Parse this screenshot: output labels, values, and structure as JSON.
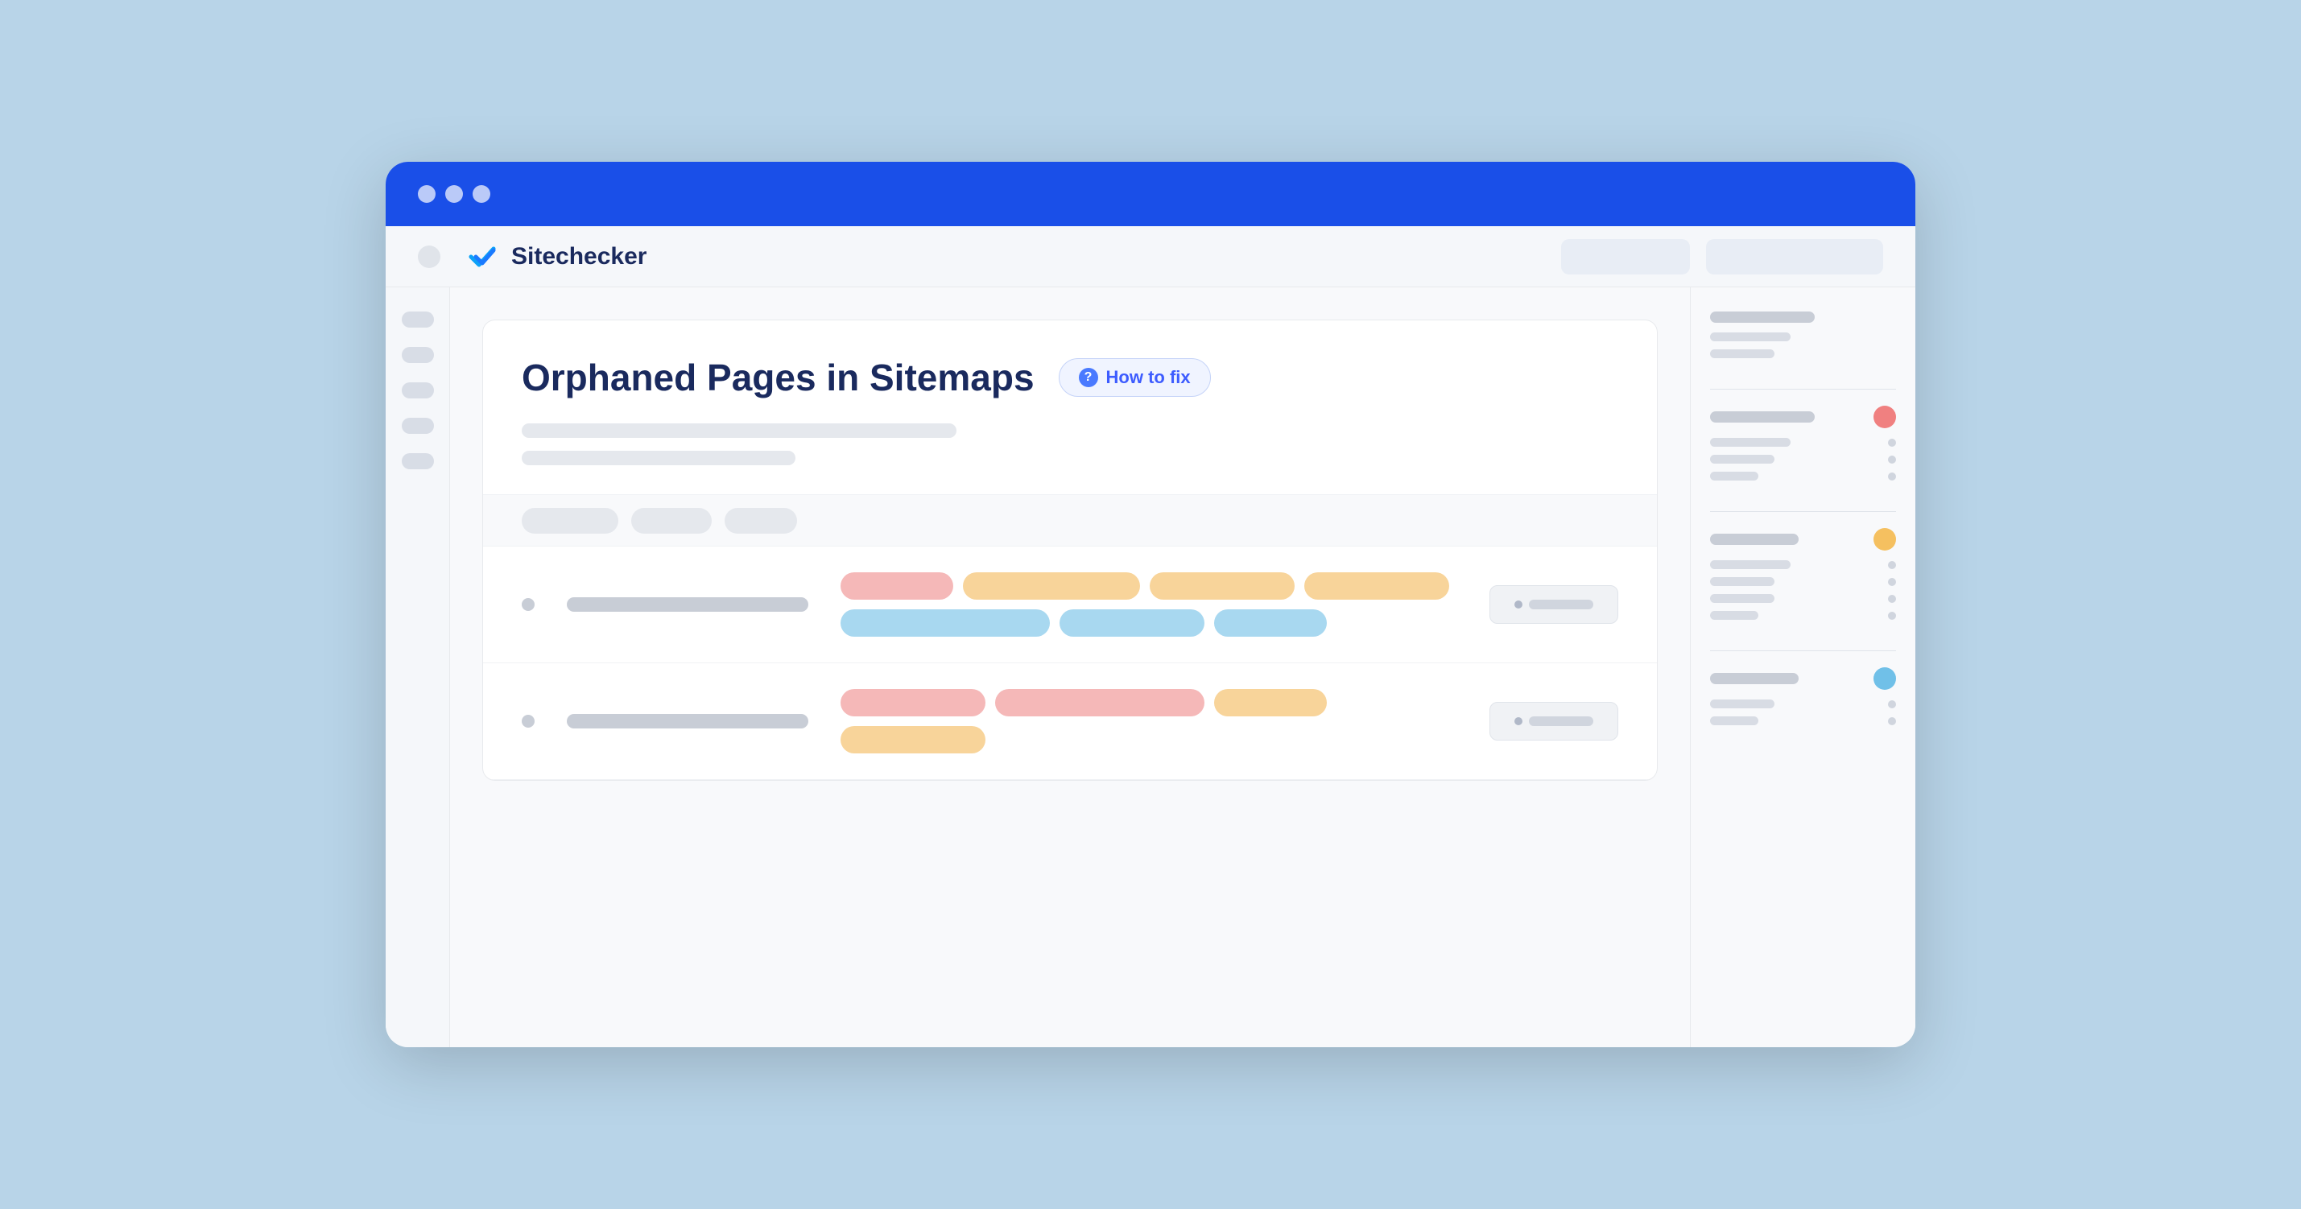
{
  "browser": {
    "title": "Sitechecker",
    "dots": [
      "dot1",
      "dot2",
      "dot3"
    ],
    "btn1_label": "",
    "btn2_label": ""
  },
  "page": {
    "title": "Orphaned Pages in Sitemaps",
    "how_to_fix": "How to fix",
    "desc_line1": "",
    "desc_line2": ""
  },
  "sidebar_items": [
    "item1",
    "item2",
    "item3",
    "item4",
    "item5"
  ],
  "table": {
    "rows": [
      {
        "tags": [
          {
            "color": "pink",
            "size": "sm"
          },
          {
            "color": "orange",
            "size": "lg"
          },
          {
            "color": "orange",
            "size": "md"
          },
          {
            "color": "orange",
            "size": "md"
          },
          {
            "color": "blue",
            "size": "xl"
          },
          {
            "color": "blue",
            "size": "md"
          },
          {
            "color": "blue",
            "size": "sm"
          }
        ]
      },
      {
        "tags": [
          {
            "color": "pink",
            "size": "md"
          },
          {
            "color": "pink",
            "size": "xl"
          },
          {
            "color": "orange",
            "size": "sm"
          },
          {
            "color": "orange",
            "size": "md"
          }
        ]
      }
    ]
  },
  "right_sidebar": {
    "sections": [
      {
        "main_line": "lg",
        "badge": "none",
        "sub_rows": [
          {
            "line": "md",
            "dot": false
          },
          {
            "line": "sm",
            "dot": false
          }
        ]
      },
      {
        "main_line": "lg",
        "badge": "red",
        "sub_rows": [
          {
            "line": "md",
            "dot": true
          },
          {
            "line": "sm",
            "dot": true
          },
          {
            "line": "xs",
            "dot": true
          }
        ]
      },
      {
        "main_line": "md",
        "badge": "orange",
        "sub_rows": [
          {
            "line": "md",
            "dot": true
          },
          {
            "line": "sm",
            "dot": true
          },
          {
            "line": "sm",
            "dot": true
          },
          {
            "line": "xs",
            "dot": true
          }
        ]
      },
      {
        "main_line": "md",
        "badge": "blue",
        "sub_rows": [
          {
            "line": "sm",
            "dot": true
          },
          {
            "line": "xs",
            "dot": true
          }
        ]
      }
    ]
  },
  "icons": {
    "check_icon": "✓",
    "question_icon": "?"
  }
}
